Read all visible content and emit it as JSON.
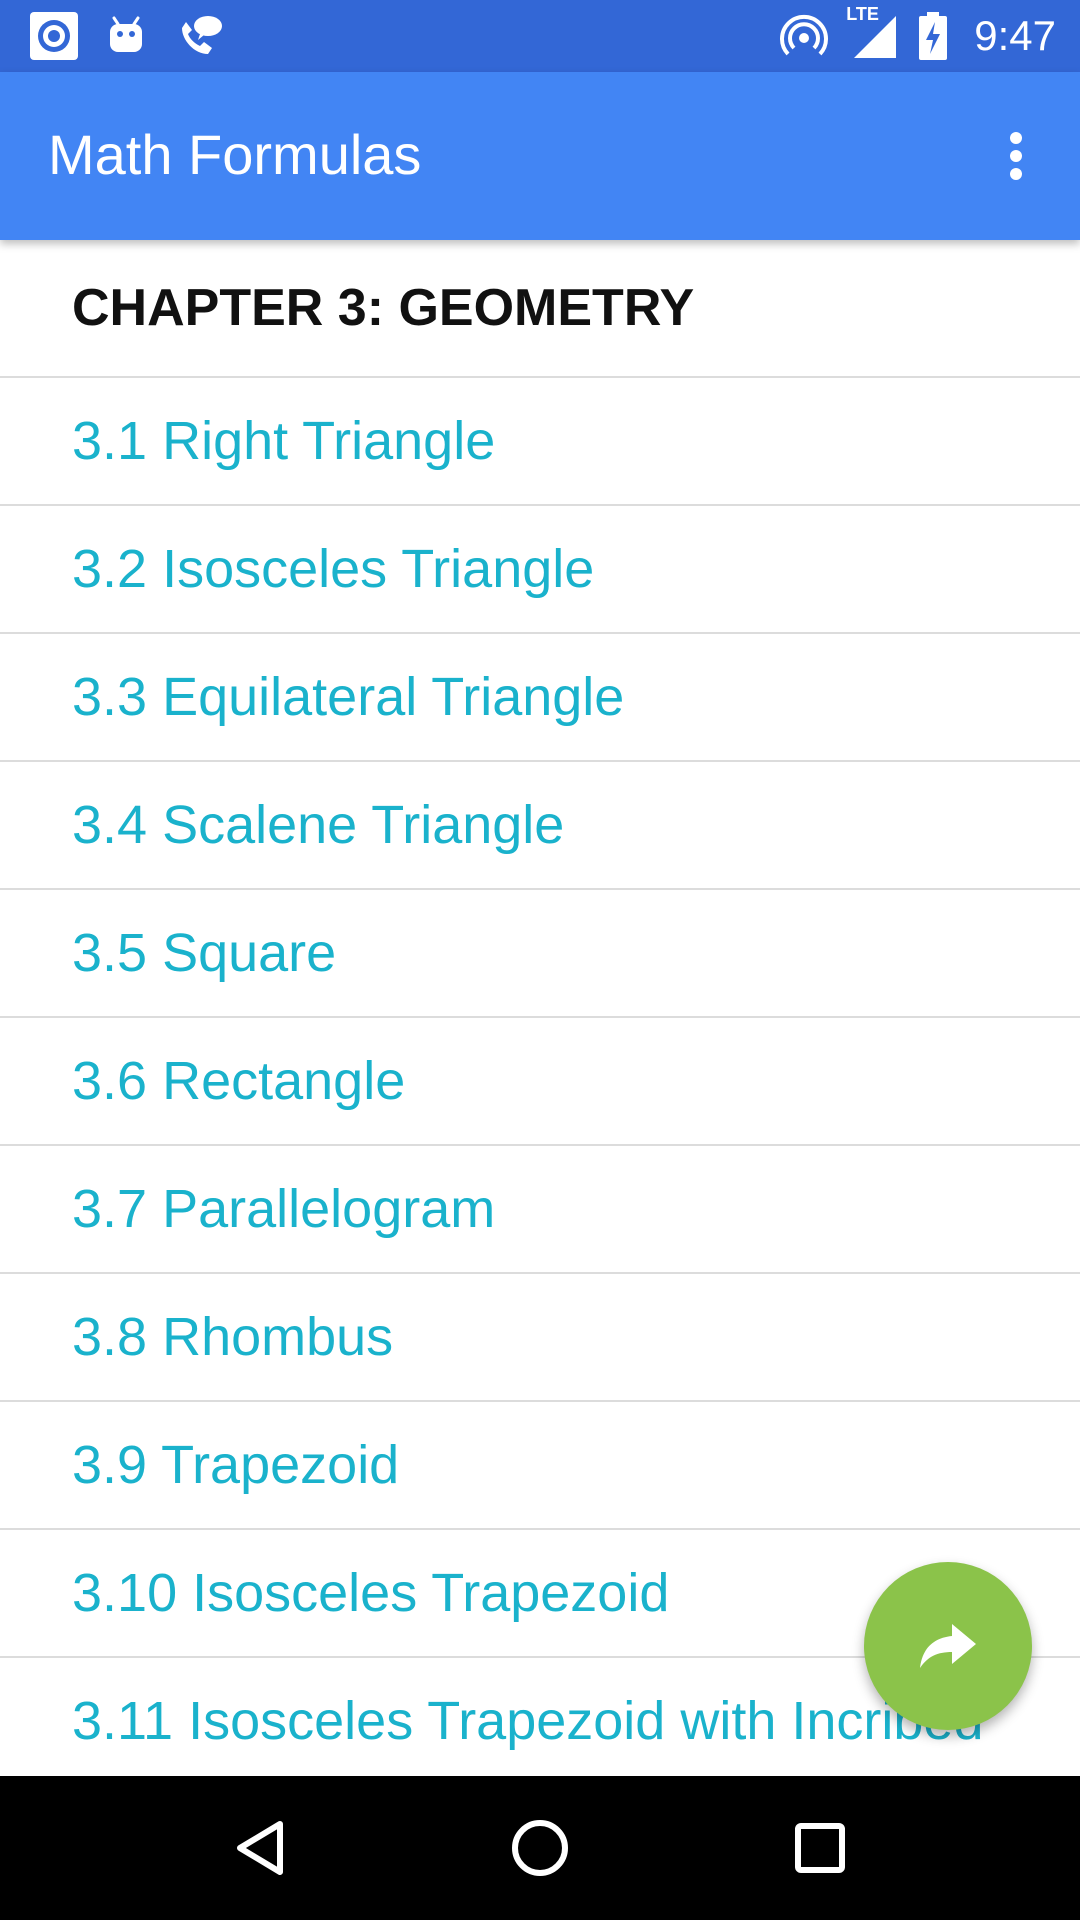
{
  "status_bar": {
    "time": "9:47",
    "network_label": "LTE",
    "left_icons": [
      "target-icon",
      "android-icon",
      "phone-chat-icon"
    ],
    "right_icons": [
      "hotspot-icon",
      "signal-icon",
      "battery-charging-icon"
    ]
  },
  "app_bar": {
    "title": "Math Formulas",
    "menu_icon": "more-vert-icon"
  },
  "chapter": {
    "title": "CHAPTER 3: GEOMETRY"
  },
  "items": [
    {
      "label": "3.1 Right Triangle"
    },
    {
      "label": "3.2 Isosceles Triangle"
    },
    {
      "label": "3.3 Equilateral Triangle"
    },
    {
      "label": "3.4 Scalene Triangle"
    },
    {
      "label": "3.5 Square"
    },
    {
      "label": "3.6 Rectangle"
    },
    {
      "label": "3.7 Parallelogram"
    },
    {
      "label": "3.8 Rhombus"
    },
    {
      "label": "3.9 Trapezoid"
    },
    {
      "label": "3.10 Isosceles Trapezoid"
    },
    {
      "label": "3.11 Isosceles Trapezoid with Incribed"
    }
  ],
  "fab": {
    "icon": "forward-arrow-icon",
    "color": "#8bc34a"
  },
  "colors": {
    "status_bar": "#3367d6",
    "app_bar": "#4285f4",
    "item_text": "#1ab2cc"
  },
  "nav_bar": {
    "buttons": [
      "back-icon",
      "home-icon",
      "recents-icon"
    ]
  }
}
